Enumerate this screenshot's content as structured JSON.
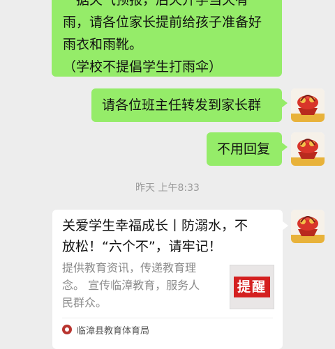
{
  "messages": {
    "m1_lines": [
      "一据天气预报，后天开学当天有",
      "雨，请各位家长提前给孩子准备好",
      "雨衣和雨靴。",
      "（学校不提倡学生打雨伞）"
    ],
    "m2": "请各位班主任转发到家长群",
    "m3": "不用回复"
  },
  "timestamp": "昨天 上午8:33",
  "article_card": {
    "title_lines": [
      "关爱学生幸福成长丨防溺水，不",
      "放松！“六个不”，请牢记！"
    ],
    "desc_lines": [
      "提供教育资讯，传递教育理",
      "念。 宣传临漳教育，服务人",
      "民群众。"
    ],
    "thumbnail_text": "提醒",
    "source": "临漳县教育体育局"
  },
  "avatar_icon": "flower-basket-icon",
  "colors": {
    "chat_bg": "#ededed",
    "sent_bubble": "#95ec69",
    "card_bg": "#ffffff",
    "thumb_red": "#d42020"
  }
}
